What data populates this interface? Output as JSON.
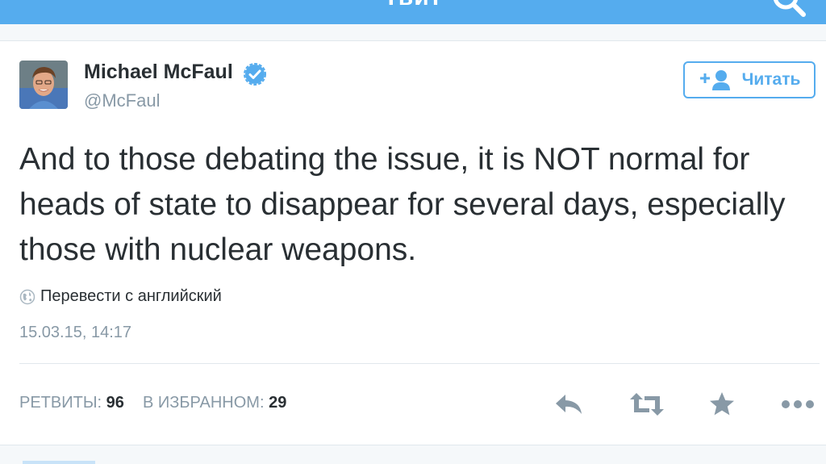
{
  "header": {
    "title": "Твит",
    "search_icon": "search-icon"
  },
  "tweet": {
    "author": {
      "display_name": "Michael McFaul",
      "handle": "@McFaul",
      "verified": true
    },
    "follow_button": {
      "label": "Читать",
      "icon": "add-user-icon"
    },
    "text": "And to those debating the issue, it is NOT normal for heads of state to disappear for several days, especially those with nuclear weapons.",
    "translate_label": "Перевести с английский",
    "timestamp": "15.03.15, 14:17",
    "stats": {
      "retweets_label": "РЕТВИТЫ:",
      "retweets_count": "96",
      "favorites_label": "В ИЗБРАННОМ:",
      "favorites_count": "29"
    },
    "actions": [
      "reply-icon",
      "retweet-icon",
      "favorite-icon",
      "more-icon"
    ]
  },
  "colors": {
    "accent": "#55acee",
    "text": "#292f33",
    "muted": "#8899a6",
    "divider": "#e1e8ed"
  }
}
